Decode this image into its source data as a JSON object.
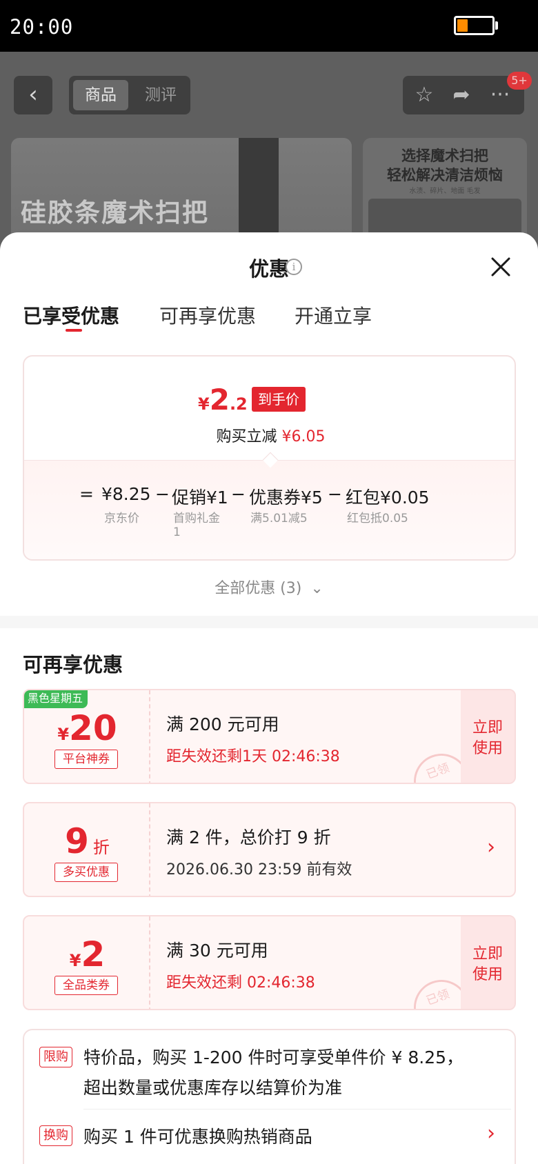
{
  "status_bar": {
    "time": "20:00",
    "battery_level": 0.3
  },
  "background_page": {
    "tabs": {
      "active": "商品",
      "inactive": "测评"
    },
    "badge": "5+",
    "banner_title": "硅胶条魔术扫把",
    "side_banner": {
      "line1": "选择魔术扫把",
      "line2": "轻松解决清洁烦恼",
      "sub": "水渍、碎片、地面 毛发"
    }
  },
  "sheet": {
    "title": "优惠",
    "tabs": [
      "已享受优惠",
      "可再享优惠",
      "开通立享"
    ],
    "summary": {
      "price_symbol": "¥",
      "price_int": "2",
      "price_dec": ".2",
      "price_tag": "到手价",
      "saving_label": "购买立减",
      "saving_amount": "¥6.05",
      "calc": [
        {
          "op": "=",
          "label": "",
          "value": "¥8.25",
          "sub": "京东价",
          "sub2": ""
        },
        {
          "op": "−",
          "label": "促销",
          "value": "¥1",
          "sub": "首购礼金",
          "sub2": "1"
        },
        {
          "op": "−",
          "label": "优惠券",
          "value": "¥5",
          "sub": "满5.01减5",
          "sub2": ""
        },
        {
          "op": "−",
          "label": "红包",
          "value": "¥0.05",
          "sub": "红包抵0.05",
          "sub2": ""
        }
      ]
    },
    "all_offers": "全部优惠 (3)",
    "section_title": "可再享优惠",
    "coupons": [
      {
        "flag": "黑色星期五",
        "yen": "¥",
        "amount": "20",
        "unit": "",
        "type": "平台神券",
        "main": "满 200 元可用",
        "sub": "距失效还剩1天 02:46:38",
        "action": [
          "立即",
          "使用"
        ],
        "stamp": "已领"
      },
      {
        "flag": "",
        "yen": "",
        "amount": "9",
        "unit": "折",
        "type": "多买优惠",
        "main": "满 2 件，总价打 9 折",
        "sub": "2026.06.30 23:59 前有效",
        "action": [],
        "stamp": ""
      },
      {
        "flag": "",
        "yen": "¥",
        "amount": "2",
        "unit": "",
        "type": "全品类券",
        "main": "满 30 元可用",
        "sub": "距失效还剩 02:46:38",
        "action": [
          "立即",
          "使用"
        ],
        "stamp": "已领"
      }
    ],
    "limits": [
      {
        "tag": "限购",
        "line1": "特价品，购买 1-200 件时可享受单件价 ¥ 8.25，",
        "line2": "超出数量或优惠库存以结算价为准"
      },
      {
        "tag": "换购",
        "line1": "购买 1 件可优惠换购热销商品",
        "line2": ""
      }
    ]
  },
  "colors": {
    "accent": "#e3262f",
    "flag_green": "#3dba56",
    "battery": "#ff8c00"
  }
}
